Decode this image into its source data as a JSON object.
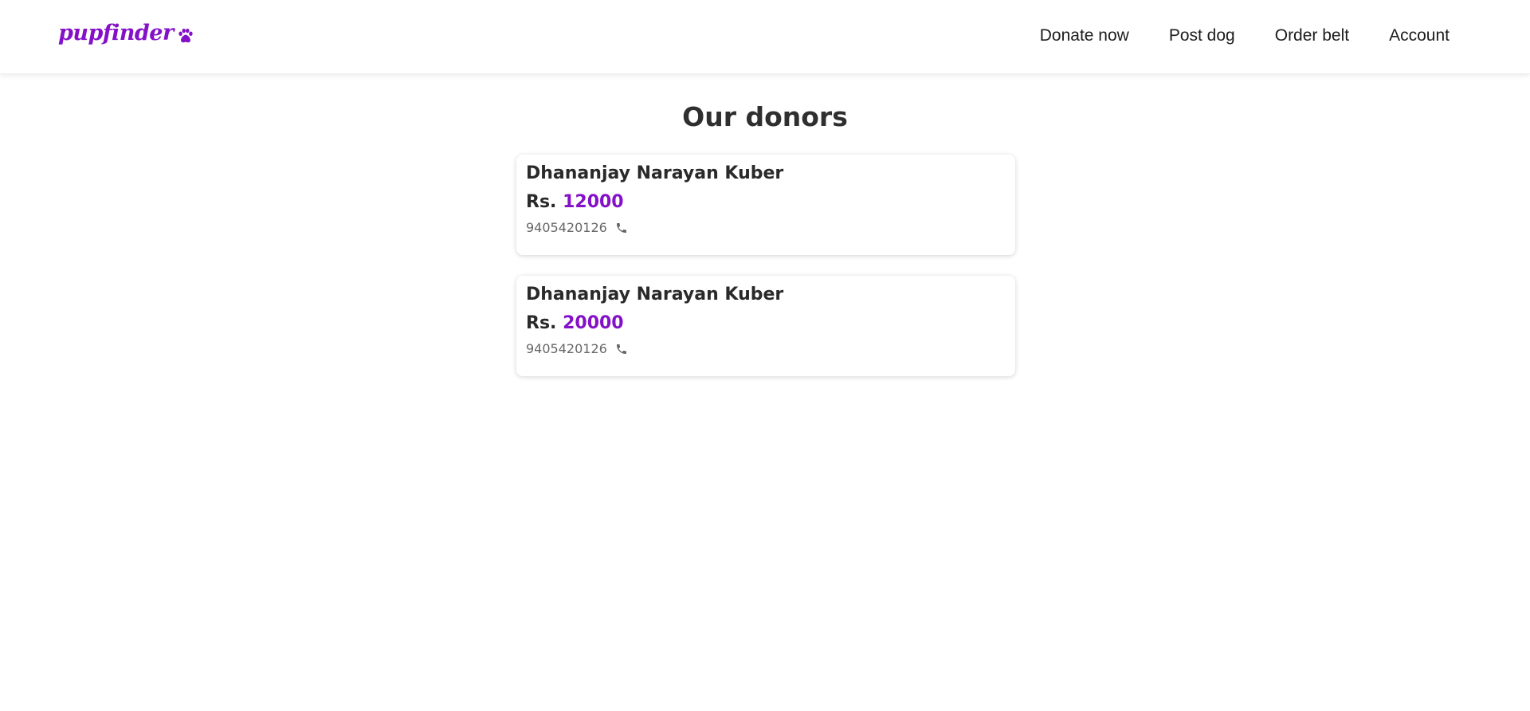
{
  "brand": {
    "name": "pupfinder",
    "icon": "paw-icon",
    "accent_color": "#8410c8"
  },
  "nav": {
    "items": [
      {
        "label": "Donate now"
      },
      {
        "label": "Post dog"
      },
      {
        "label": "Order belt"
      },
      {
        "label": "Account"
      }
    ]
  },
  "main": {
    "title": "Our donors",
    "donors": [
      {
        "name": "Dhananjay Narayan Kuber",
        "currency": "Rs.",
        "amount": "12000",
        "phone": "9405420126",
        "phone_icon": "phone-icon"
      },
      {
        "name": "Dhananjay Narayan Kuber",
        "currency": "Rs.",
        "amount": "20000",
        "phone": "9405420126",
        "phone_icon": "phone-icon"
      }
    ]
  }
}
